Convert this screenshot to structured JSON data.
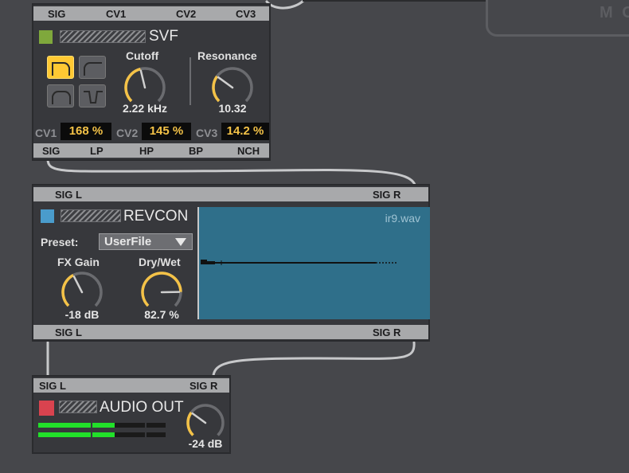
{
  "colors": {
    "background": "#46474b",
    "module_bg": "#37383c",
    "port_bar": "#a8a9ab",
    "knob_accent": "#f4c247",
    "svf_swatch": "#7fa83c",
    "revcon_swatch": "#4a9ccc",
    "audio_out_swatch": "#d9434f",
    "meter_green": "#22e02a",
    "cable": "#c7c8ca"
  },
  "top_right": {
    "label": "M C"
  },
  "svf": {
    "title": "SVF",
    "top_ports": [
      "SIG",
      "CV1",
      "CV2",
      "CV3"
    ],
    "bottom_ports": [
      "SIG",
      "LP",
      "HP",
      "BP",
      "NCH"
    ],
    "filter_modes": [
      {
        "name": "lowpass-icon",
        "active": true
      },
      {
        "name": "highpass-icon",
        "active": false
      },
      {
        "name": "bandpass-icon",
        "active": false
      },
      {
        "name": "notch-icon",
        "active": false
      }
    ],
    "cutoff": {
      "label": "Cutoff",
      "value": "2.22 kHz",
      "level": 0.45
    },
    "resonance": {
      "label": "Resonance",
      "value": "10.32",
      "level": 0.3
    },
    "cv": [
      {
        "label": "CV1",
        "value": "168 %"
      },
      {
        "label": "CV2",
        "value": "145 %"
      },
      {
        "label": "CV3",
        "value": "14.2 %"
      }
    ]
  },
  "revcon": {
    "title": "REVCON",
    "top_ports": [
      "SIG L",
      "SIG R"
    ],
    "bottom_ports": [
      "SIG L",
      "SIG R"
    ],
    "preset_label": "Preset:",
    "preset_value": "UserFile",
    "fx_gain": {
      "label": "FX Gain",
      "value": "-18 dB",
      "level": 0.4
    },
    "dry_wet": {
      "label": "Dry/Wet",
      "value": "82.7 %",
      "level": 0.83
    },
    "ir_file": "ir9.wav"
  },
  "audio_out": {
    "title": "AUDIO OUT",
    "top_ports": [
      "SIG L",
      "SIG R"
    ],
    "volume": {
      "value": "-24 dB",
      "level": 0.3
    },
    "meter_left_level": 0.6,
    "meter_right_level": 0.6
  }
}
